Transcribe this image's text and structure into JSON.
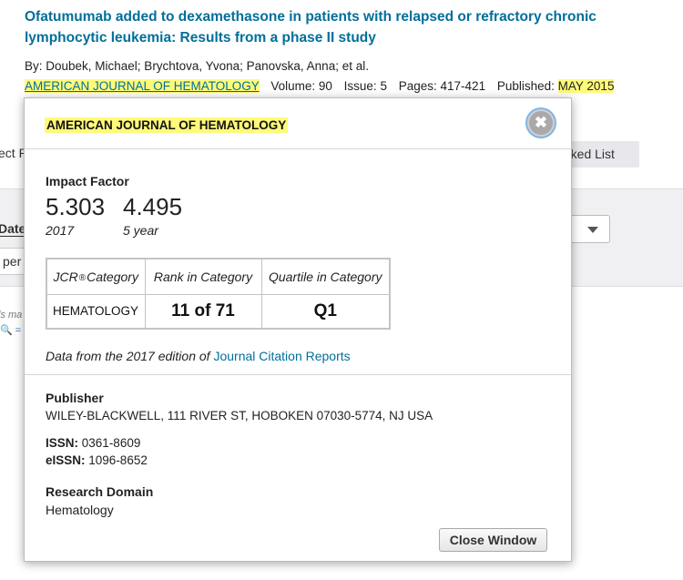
{
  "record": {
    "title": "Ofatumumab added to dexamethasone in patients with relapsed or refractory chronic lymphocytic leukemia: Results from a phase II study",
    "authors": "By: Doubek, Michael; Brychtova, Yvona; Panovska, Anna; et al.",
    "journal": "AMERICAN JOURNAL OF HEMATOLOGY",
    "volume_label": "Volume:",
    "volume": "90",
    "issue_label": "Issue:",
    "issue": "5",
    "pages_label": "Pages:",
    "pages": "417-421",
    "published_label": "Published:",
    "published": "MAY 2015"
  },
  "background": {
    "select_fragment": "ect P",
    "marked_list_fragment": "rked List",
    "date_fragment": "Date",
    "per_fragment": "per",
    "italic_fragment": "ls ma",
    "icon_fragment": "🔍 ="
  },
  "popup": {
    "journal_title": "AMERICAN JOURNAL OF HEMATOLOGY",
    "close_x": "✖",
    "impact_factor_label": "Impact Factor",
    "impact_factor": {
      "value": "5.303",
      "year": "2017"
    },
    "five_year": {
      "value": "4.495",
      "label": "5 year"
    },
    "table": {
      "headers": {
        "category_prefix": "JCR",
        "reg_mark": "®",
        "category_suffix": "Category",
        "rank": "Rank in Category",
        "quartile": "Quartile in Category"
      },
      "rows": [
        {
          "category": "HEMATOLOGY",
          "rank": "11 of 71",
          "quartile": "Q1"
        }
      ]
    },
    "jcr_note_prefix": "Data from the 2017 edition of ",
    "jcr_note_link": "Journal Citation Reports",
    "publisher_label": "Publisher",
    "publisher": "WILEY-BLACKWELL, 111 RIVER ST, HOBOKEN 07030-5774, NJ USA",
    "issn_label": "ISSN:",
    "issn": "0361-8609",
    "eissn_label": "eISSN:",
    "eissn": "1096-8652",
    "research_domain_label": "Research Domain",
    "research_domain": "Hematology",
    "close_button": "Close Window"
  },
  "colors": {
    "link": "#006f9a",
    "highlight": "#fffa7a"
  }
}
